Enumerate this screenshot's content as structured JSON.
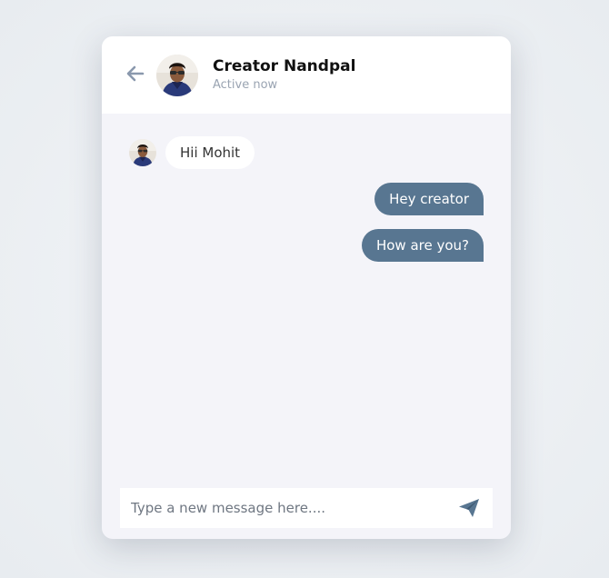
{
  "header": {
    "name": "Creator Nandpal",
    "status": "Active now"
  },
  "messages": {
    "incoming": [
      {
        "text": "Hii Mohit"
      }
    ],
    "outgoing": [
      {
        "text": "Hey creator"
      },
      {
        "text": "How are you?"
      }
    ]
  },
  "composer": {
    "placeholder": "Type a new message here...."
  },
  "icons": {
    "back": "arrow-left-icon",
    "send": "paper-plane-icon"
  },
  "colors": {
    "outgoing_bubble": "#587691",
    "chat_background": "#f4f4f9",
    "header_background": "#ffffff",
    "status_text": "#9aa4b2"
  }
}
